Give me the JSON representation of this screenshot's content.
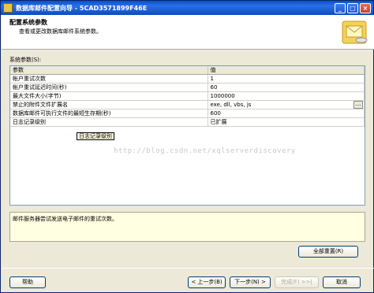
{
  "window": {
    "title": "数据库邮件配置向导 - 5CAD3571899F46E"
  },
  "header": {
    "title": "配置系统参数",
    "subtitle": "查看或更改数据库邮件系统参数。"
  },
  "section_label": "系统参数(S):",
  "grid": {
    "columns": [
      "参数",
      "值"
    ],
    "rows": [
      {
        "param": "帐户重试次数",
        "value": "1"
      },
      {
        "param": "帐户重试延迟时间(秒)",
        "value": "60"
      },
      {
        "param": "最大文件大小(字节)",
        "value": "1000000"
      },
      {
        "param": "禁止的附件文件扩展名",
        "value": "exe, dll, vbs, js"
      },
      {
        "param": "数据库邮件可执行文件的最短生存期(秒)",
        "value": "600"
      },
      {
        "param": "日志记录级别",
        "value": "已扩展"
      }
    ],
    "tooltip": "日志记录级别",
    "watermark": "http://blog.csdn.net/xqlserverdiscovery"
  },
  "description": "邮件服务器尝试发送电子邮件的重试次数。",
  "buttons": {
    "reset_all": "全部重置(R)",
    "help": "帮助",
    "back": "< 上一步(B)",
    "next": "下一步(N) >",
    "finish": "完成(F) >>|",
    "cancel": "取消"
  },
  "colors": {
    "titlebar": "#0a4fc4",
    "background": "#ece9d8",
    "description_bg": "#ffffe1"
  }
}
